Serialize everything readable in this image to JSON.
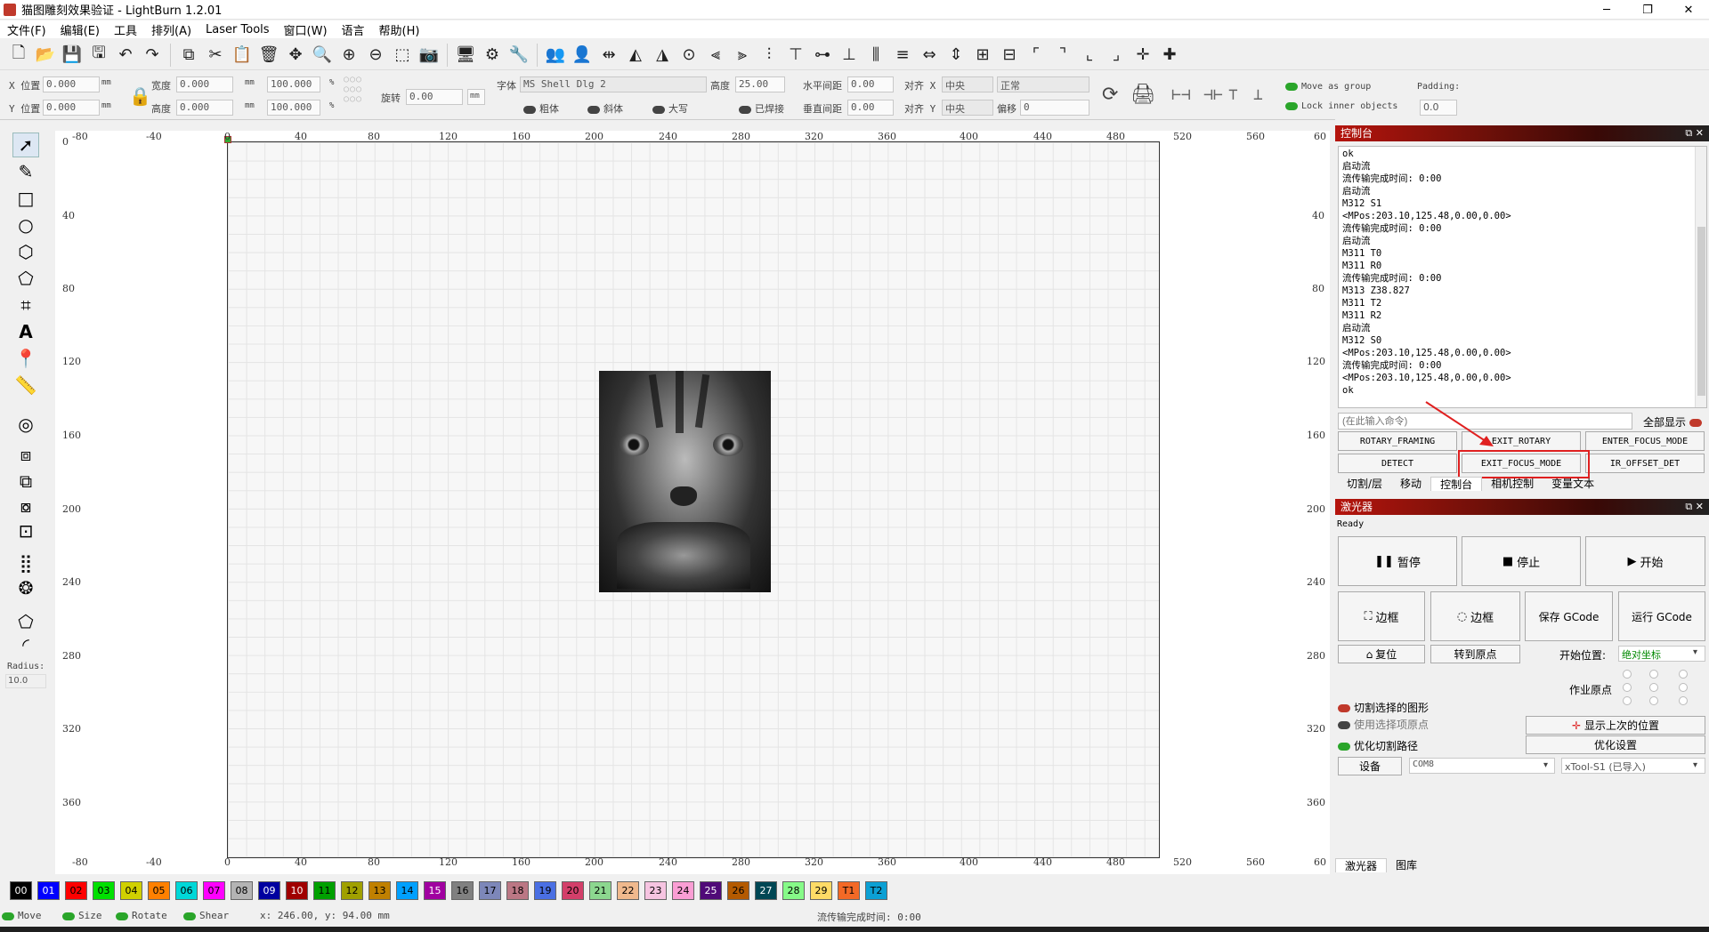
{
  "window": {
    "title": "猫图雕刻效果验证 - LightBurn 1.2.01",
    "minimize": "─",
    "maximize": "❐",
    "close": "✕"
  },
  "menu": [
    "文件(F)",
    "编辑(E)",
    "工具",
    "排列(A)",
    "Laser Tools",
    "窗口(W)",
    "语言",
    "帮助(H)"
  ],
  "props": {
    "x_label": "X 位置",
    "x_val": "0.000",
    "y_label": "Y 位置",
    "y_val": "0.000",
    "unit_mm": "mm",
    "w_label": "宽度",
    "w_val": "0.000",
    "h_label": "高度",
    "h_val": "0.000",
    "w_pct": "100.000",
    "h_pct": "100.000",
    "pct": "%",
    "rot_label": "旋转",
    "rot_val": "0.00",
    "mm_btn": "mm",
    "font_label": "字体",
    "font_val": "MS Shell Dlg 2",
    "height_label": "高度",
    "height_val": "25.00",
    "hspace_label": "水平间距",
    "hspace_val": "0.00",
    "vspace_label": "垂直间距",
    "vspace_val": "0.00",
    "alignx_label": "对齐 X",
    "alignx_val": "中央",
    "aligny_label": "对齐 Y",
    "aligny_val": "中央",
    "normal_val": "正常",
    "offset_label": "偏移",
    "offset_val": "0",
    "bold": "粗体",
    "italic": "斜体",
    "caps": "大写",
    "welded": "已焊接",
    "move_group": "Move as group",
    "lock_inner": "Lock inner objects",
    "padding_label": "Padding:",
    "padding_val": "0.0"
  },
  "lefttools": {
    "radius_label": "Radius:",
    "radius_val": "10.0"
  },
  "ruler": {
    "top": [
      "-80",
      "-40",
      "0",
      "40",
      "80",
      "120",
      "160",
      "200",
      "240",
      "280",
      "320",
      "360",
      "400",
      "440",
      "480",
      "520",
      "560",
      "60"
    ],
    "bottom": [
      "-80",
      "-40",
      "0",
      "40",
      "80",
      "120",
      "160",
      "200",
      "240",
      "280",
      "320",
      "360",
      "400",
      "440",
      "480",
      "520",
      "560",
      "60"
    ],
    "left": [
      "0",
      "40",
      "80",
      "120",
      "160",
      "200",
      "240",
      "280",
      "320",
      "360"
    ],
    "right": [
      "40",
      "80",
      "120",
      "160",
      "200",
      "240",
      "280",
      "320",
      "360"
    ]
  },
  "console": {
    "title": "控制台",
    "lines": [
      "ok",
      "启动流",
      "流传输完成时间: 0:00",
      "启动流",
      "M312 S1",
      "<MPos:203.10,125.48,0.00,0.00>",
      "流传输完成时间: 0:00",
      "启动流",
      "M311 T0",
      "M311 R0",
      "流传输完成时间: 0:00",
      "M313 Z38.827",
      "M311 T2",
      "M311 R2",
      "启动流",
      "M312 S0",
      "<MPos:203.10,125.48,0.00,0.00>",
      "流传输完成时间: 0:00",
      "<MPos:203.10,125.48,0.00,0.00>",
      "ok"
    ],
    "placeholder": "(在此输入命令)",
    "show_all": "全部显示",
    "macros": [
      "ROTARY_FRAMING",
      "EXIT_ROTARY",
      "ENTER_FOCUS_MODE",
      "DETECT",
      "EXIT_FOCUS_MODE",
      "IR_OFFSET_DET"
    ],
    "tabs": [
      "切割/层",
      "移动",
      "控制台",
      "相机控制",
      "变量文本"
    ]
  },
  "laser": {
    "title": "激光器",
    "status": "Ready",
    "pause": "暂停",
    "stop": "停止",
    "start": "开始",
    "frame1": "边框",
    "frame2": "边框",
    "save_gcode": "保存 GCode",
    "run_gcode": "运行 GCode",
    "home": "复位",
    "goto_origin": "转到原点",
    "start_from_label": "开始位置:",
    "start_from_val": "绝对坐标",
    "job_origin_label": "作业原点",
    "cut_selected": "切割选择的图形",
    "use_selection_origin": "使用选择项原点",
    "optimize_cut": "优化切割路径",
    "show_last_pos": "显示上次的位置",
    "optimize_settings": "优化设置",
    "devices": "设备",
    "port": "COM8",
    "device": "xTool-S1 (已导入)",
    "tabs": [
      "激光器",
      "图库"
    ]
  },
  "palette": [
    {
      "label": "00",
      "color": "#000000",
      "text": "#ffffff"
    },
    {
      "label": "01",
      "color": "#0000ff",
      "text": "#ffffff"
    },
    {
      "label": "02",
      "color": "#ff0000",
      "text": "#000000"
    },
    {
      "label": "03",
      "color": "#00e000",
      "text": "#000000"
    },
    {
      "label": "04",
      "color": "#d0d000",
      "text": "#000000"
    },
    {
      "label": "05",
      "color": "#ff8000",
      "text": "#000000"
    },
    {
      "label": "06",
      "color": "#00d8d8",
      "text": "#000000"
    },
    {
      "label": "07",
      "color": "#ff00ff",
      "text": "#000000"
    },
    {
      "label": "08",
      "color": "#b4b4b4",
      "text": "#000000"
    },
    {
      "label": "09",
      "color": "#0000a0",
      "text": "#ffffff"
    },
    {
      "label": "10",
      "color": "#a00000",
      "text": "#ffffff"
    },
    {
      "label": "11",
      "color": "#00a000",
      "text": "#000000"
    },
    {
      "label": "12",
      "color": "#a0a000",
      "text": "#000000"
    },
    {
      "label": "13",
      "color": "#c08000",
      "text": "#000000"
    },
    {
      "label": "14",
      "color": "#00a0ff",
      "text": "#000000"
    },
    {
      "label": "15",
      "color": "#a000a0",
      "text": "#ffffff"
    },
    {
      "label": "16",
      "color": "#808080",
      "text": "#000000"
    },
    {
      "label": "17",
      "color": "#7d87b9",
      "text": "#000000"
    },
    {
      "label": "18",
      "color": "#bb7784",
      "text": "#000000"
    },
    {
      "label": "19",
      "color": "#4a6fe3",
      "text": "#000000"
    },
    {
      "label": "20",
      "color": "#d33f6a",
      "text": "#000000"
    },
    {
      "label": "21",
      "color": "#8cd78f",
      "text": "#000000"
    },
    {
      "label": "22",
      "color": "#f0b98d",
      "text": "#000000"
    },
    {
      "label": "23",
      "color": "#f6c4e1",
      "text": "#000000"
    },
    {
      "label": "24",
      "color": "#fa9ed4",
      "text": "#000000"
    },
    {
      "label": "25",
      "color": "#500a78",
      "text": "#ffffff"
    },
    {
      "label": "26",
      "color": "#b45a00",
      "text": "#000000"
    },
    {
      "label": "27",
      "color": "#004754",
      "text": "#ffffff"
    },
    {
      "label": "28",
      "color": "#86fa88",
      "text": "#000000"
    },
    {
      "label": "29",
      "color": "#ffdb66",
      "text": "#000000"
    },
    {
      "label": "T1",
      "color": "#f36926",
      "text": "#000000"
    },
    {
      "label": "T2",
      "color": "#0ca0d4",
      "text": "#000000"
    }
  ],
  "status": {
    "move": "Move",
    "size": "Size",
    "rotate": "Rotate",
    "shear": "Shear",
    "coords": "x: 246.00, y: 94.00 mm",
    "stream": "流传输完成时间: 0:00"
  }
}
